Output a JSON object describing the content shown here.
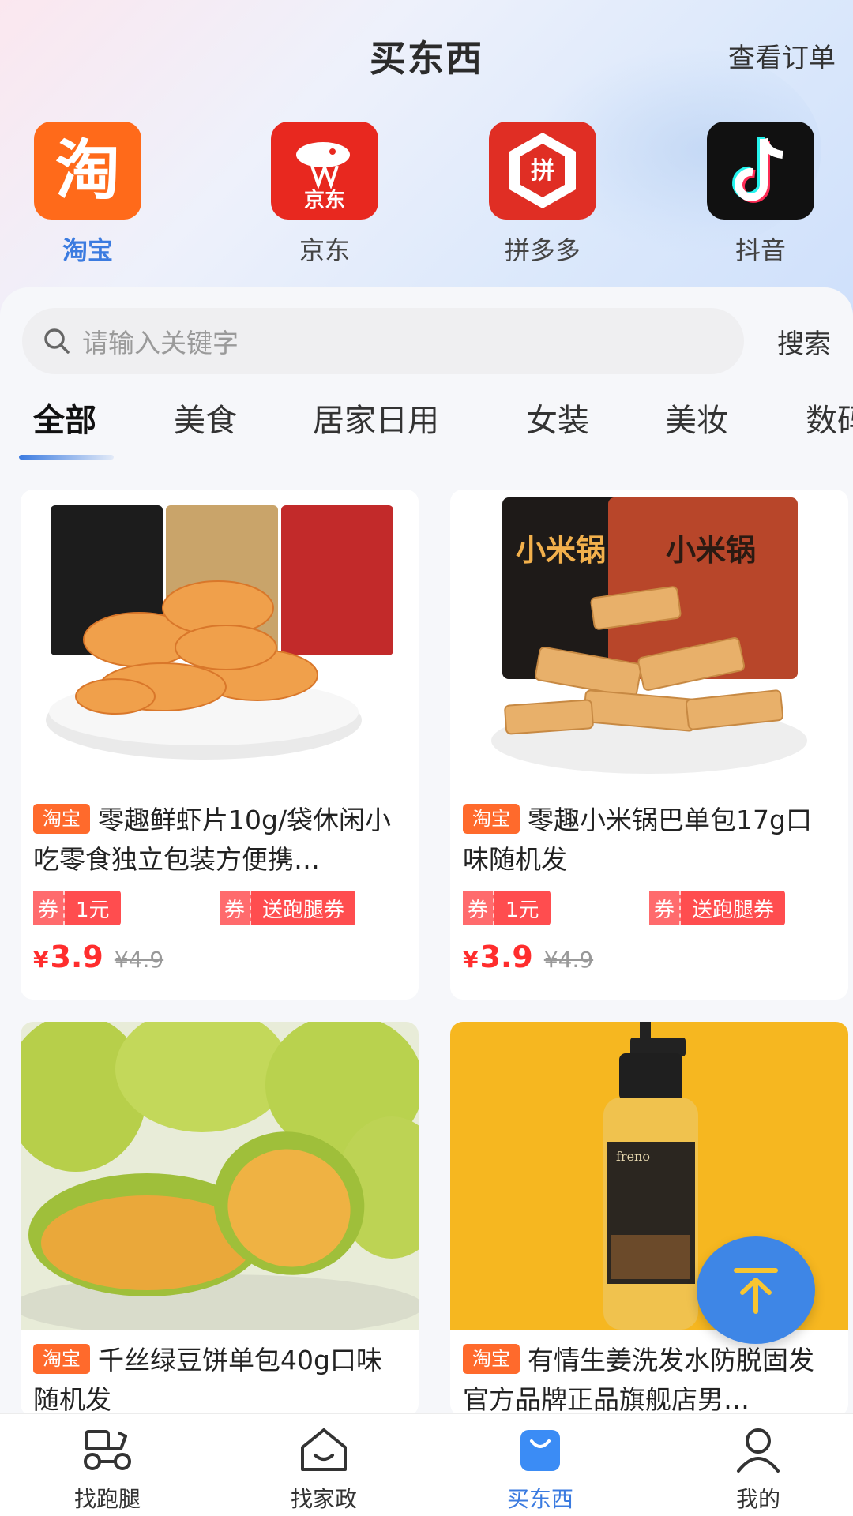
{
  "header": {
    "title": "买东西",
    "orders_link": "查看订单"
  },
  "platforms": [
    {
      "label": "淘宝",
      "icon": "taobao-logo",
      "color": "#ff6a1a",
      "active": true
    },
    {
      "label": "京东",
      "icon": "jd-logo",
      "color": "#e8281f",
      "active": false
    },
    {
      "label": "拼多多",
      "icon": "pinduoduo-logo",
      "color": "#e02e24",
      "active": false
    },
    {
      "label": "抖音",
      "icon": "douyin-logo",
      "color": "#111111",
      "active": false
    }
  ],
  "search": {
    "placeholder": "请输入关键字",
    "button": "搜索"
  },
  "tabs": [
    "全部",
    "美食",
    "居家日用",
    "女装",
    "美妆",
    "数码"
  ],
  "active_tab": "全部",
  "products": [
    {
      "badge": "淘宝",
      "name": "零趣鲜虾片10g/袋休闲小吃零食独立包装方便携…",
      "coupon1_tag": "券",
      "coupon1_text": "1元",
      "coupon2_tag": "券",
      "coupon2_text": "送跑腿券",
      "currency": "¥",
      "price": "3.9",
      "original_price": "¥4.9"
    },
    {
      "badge": "淘宝",
      "name": "零趣小米锅巴单包17g口味随机发",
      "coupon1_tag": "券",
      "coupon1_text": "1元",
      "coupon2_tag": "券",
      "coupon2_text": "送跑腿券",
      "currency": "¥",
      "price": "3.9",
      "original_price": "¥4.9"
    },
    {
      "badge": "淘宝",
      "name": "千丝绿豆饼单包40g口味随机发"
    },
    {
      "badge": "淘宝",
      "name": "有情生姜洗发水防脱固发官方品牌正品旗舰店男…"
    }
  ],
  "bottom_nav": [
    {
      "label": "找跑腿",
      "icon": "delivery-scooter-icon",
      "active": false
    },
    {
      "label": "找家政",
      "icon": "house-icon",
      "active": false
    },
    {
      "label": "买东西",
      "icon": "shopping-bag-icon",
      "active": true
    },
    {
      "label": "我的",
      "icon": "user-icon",
      "active": false
    }
  ],
  "colors": {
    "accent": "#3b7be0",
    "price": "#ff2d2d",
    "badge": "#ff6a2c",
    "coupon": "#ff4d4f"
  }
}
